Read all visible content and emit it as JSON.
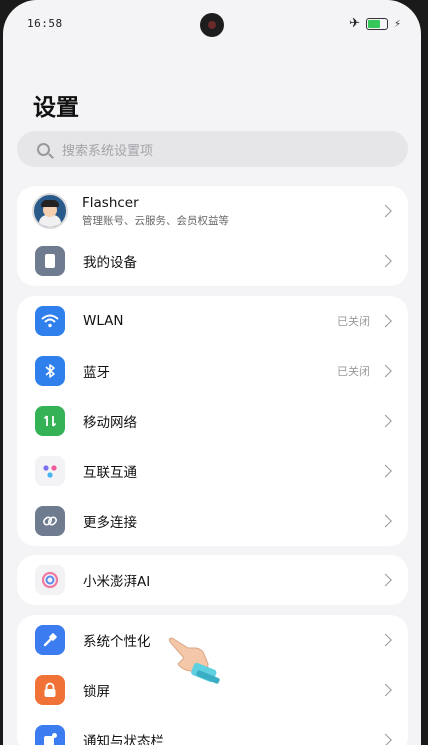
{
  "status_bar": {
    "time": "16:58",
    "battery_level": 0.6
  },
  "page": {
    "title": "设置"
  },
  "search": {
    "placeholder": "搜索系统设置项"
  },
  "account": {
    "name": "Flashcer",
    "subtitle": "管理账号、云服务、会员权益等"
  },
  "groups": {
    "device": {
      "my_device": "我的设备"
    },
    "connect": {
      "wlan": {
        "label": "WLAN",
        "status": "已关闭"
      },
      "bluetooth": {
        "label": "蓝牙",
        "status": "已关闭"
      },
      "mobile": {
        "label": "移动网络"
      },
      "interconnect": {
        "label": "互联互通"
      },
      "more": {
        "label": "更多连接"
      }
    },
    "ai": {
      "label": "小米澎湃AI"
    },
    "personal": {
      "theme": {
        "label": "系统个性化"
      },
      "lock": {
        "label": "锁屏"
      },
      "notify": {
        "label": "通知与状态栏"
      }
    }
  },
  "colors": {
    "wlan": "#2f80ed",
    "bluetooth": "#2f80ed",
    "mobile": "#34b255",
    "more": "#6f7b8f",
    "theme": "#3b7cf0",
    "lock": "#f07236",
    "notify": "#3b7cf0"
  }
}
